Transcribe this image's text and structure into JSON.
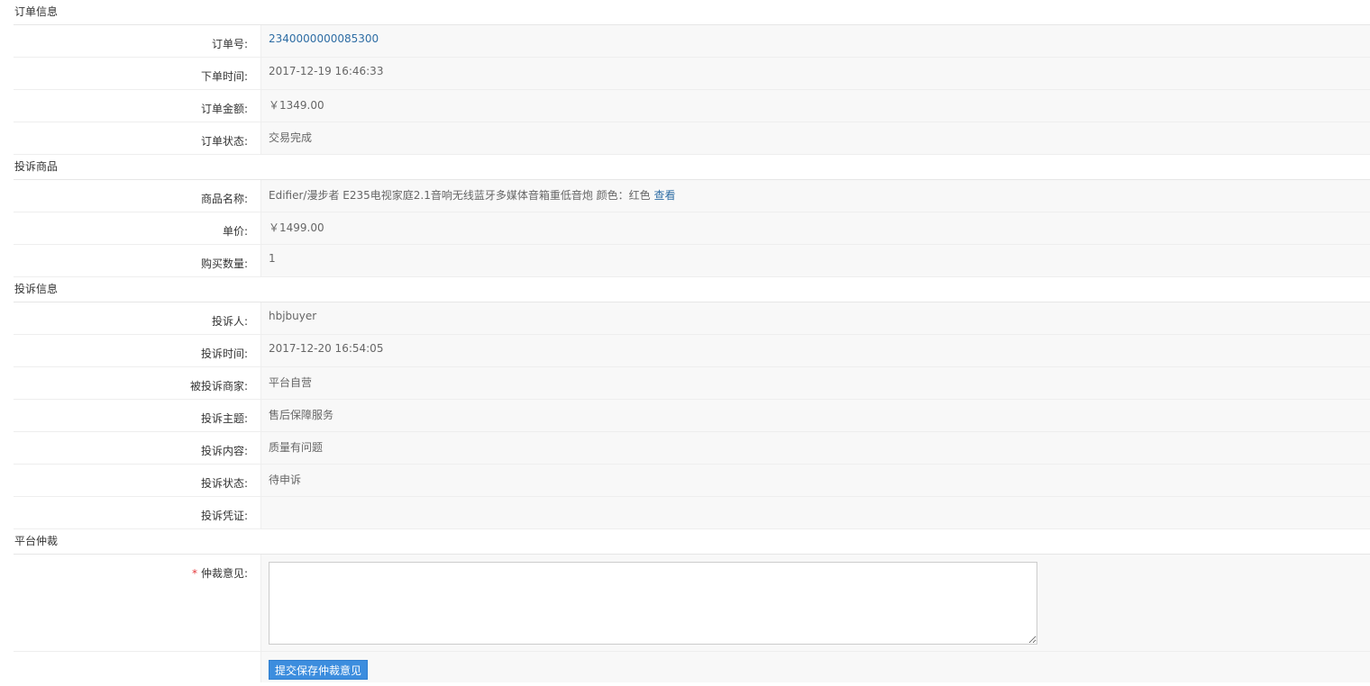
{
  "sections": {
    "order": {
      "title": "订单信息",
      "order_no_label": "订单号:",
      "order_no_value": "2340000000085300",
      "order_time_label": "下单时间:",
      "order_time_value": "2017-12-19 16:46:33",
      "order_amount_label": "订单金额:",
      "order_amount_value": "￥1349.00",
      "order_status_label": "订单状态:",
      "order_status_value": "交易完成"
    },
    "product": {
      "title": "投诉商品",
      "name_label": "商品名称:",
      "name_value": "Edifier/漫步者 E235电视家庭2.1音响无线蓝牙多媒体音箱重低音炮 颜色：红色",
      "view_link": "查看",
      "price_label": "单价:",
      "price_value": "￥1499.00",
      "qty_label": "购买数量:",
      "qty_value": "1"
    },
    "complaint": {
      "title": "投诉信息",
      "complainant_label": "投诉人:",
      "complainant_value": "hbjbuyer",
      "time_label": "投诉时间:",
      "time_value": "2017-12-20 16:54:05",
      "merchant_label": "被投诉商家:",
      "merchant_value": "平台自营",
      "subject_label": "投诉主题:",
      "subject_value": "售后保障服务",
      "content_label": "投诉内容:",
      "content_value": "质量有问题",
      "status_label": "投诉状态:",
      "status_value": "待申诉",
      "evidence_label": "投诉凭证:",
      "evidence_value": ""
    },
    "arbitration": {
      "title": "平台仲裁",
      "required_mark": "*",
      "opinion_label": "仲裁意见:",
      "opinion_value": "",
      "submit_label": "提交保存仲裁意见"
    }
  },
  "colors": {
    "link": "#2e6da4",
    "button": "#3c8dde",
    "required": "#e4393c"
  }
}
